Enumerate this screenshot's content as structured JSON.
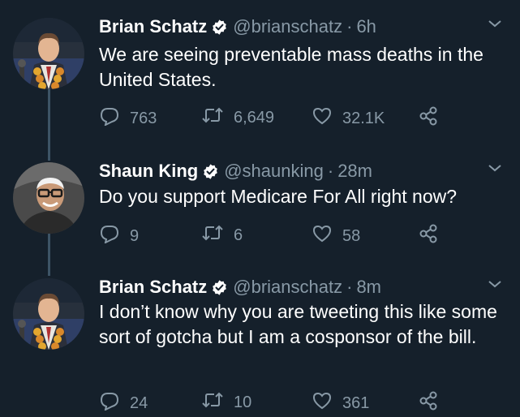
{
  "tweets": [
    {
      "name": "Brian Schatz",
      "handle": "@brianschatz",
      "time": "6h",
      "text": "We are seeing preventable mass deaths in the United States.",
      "replies": "763",
      "retweets": "6,649",
      "likes": "32.1K"
    },
    {
      "name": "Shaun King",
      "handle": "@shaunking",
      "time": "28m",
      "text": "Do you support Medicare For All right now?",
      "replies": "9",
      "retweets": "6",
      "likes": "58"
    },
    {
      "name": "Brian Schatz",
      "handle": "@brianschatz",
      "time": "8m",
      "text": "I don’t know why you are tweeting this like some sort of gotcha but I am a cosponsor of the bill.",
      "replies": "24",
      "retweets": "10",
      "likes": "361"
    }
  ],
  "separator": "·",
  "colors": {
    "background": "#15202b",
    "secondary_text": "#8899a6",
    "verified": "#ffffff",
    "thread_line": "#3d5466"
  },
  "icons": [
    "verified-badge-icon",
    "chevron-down-icon",
    "reply-icon",
    "retweet-icon",
    "like-icon",
    "share-icon"
  ]
}
